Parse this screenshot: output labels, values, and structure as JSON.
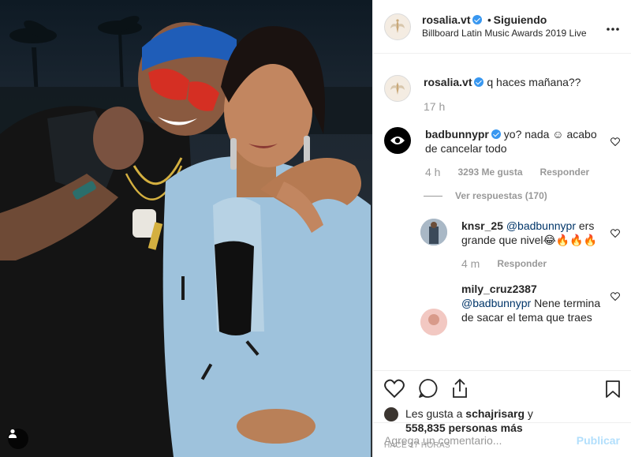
{
  "header": {
    "username": "rosalia.vt",
    "separator": "•",
    "follow_status": "Siguiendo",
    "location": "Billboard Latin Music Awards 2019 Live",
    "more_icon": "more-horizontal-icon"
  },
  "caption": {
    "username": "rosalia.vt",
    "text": "q haces mañana??",
    "time": "17 h"
  },
  "comments": [
    {
      "username": "badbunnypr",
      "text": "yo? nada ☺ acabo de cancelar todo",
      "time": "4 h",
      "likes": "3293 Me gusta",
      "reply_label": "Responder",
      "view_replies": "Ver respuestas (170)"
    }
  ],
  "replies": [
    {
      "username": "knsr_25",
      "mention": "@badbunnypr",
      "text": "ers grande que nivel😂🔥🔥🔥",
      "time": "4 m",
      "reply_label": "Responder"
    },
    {
      "username": "mily_cruz2387",
      "mention": "@badbunnypr",
      "text": "Nene termina de sacar el tema que traes"
    }
  ],
  "likes_line": {
    "prefix": "Les gusta a ",
    "user": "schajrisarg",
    "middle": " y ",
    "count": "558,835 personas más"
  },
  "timestamp": "HACE 17 HORAS",
  "add_comment": {
    "placeholder": "Agrega un comentario...",
    "post_label": "Publicar"
  },
  "colors": {
    "verified": "#3897f0",
    "post_disabled": "#b2dffc",
    "mention": "#003569"
  }
}
